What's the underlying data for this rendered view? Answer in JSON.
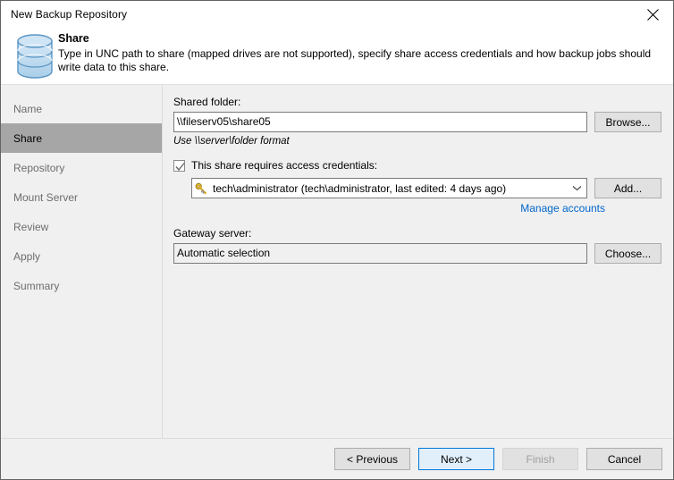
{
  "window": {
    "title": "New Backup Repository",
    "close_icon": "close-icon"
  },
  "header": {
    "icon": "database-icon",
    "title": "Share",
    "description": "Type in UNC path to share (mapped drives are not supported), specify share access credentials and how backup jobs should write data to this share."
  },
  "sidebar": {
    "items": [
      {
        "label": "Name",
        "active": false
      },
      {
        "label": "Share",
        "active": true
      },
      {
        "label": "Repository",
        "active": false
      },
      {
        "label": "Mount Server",
        "active": false
      },
      {
        "label": "Review",
        "active": false
      },
      {
        "label": "Apply",
        "active": false
      },
      {
        "label": "Summary",
        "active": false
      }
    ]
  },
  "main": {
    "shared_folder": {
      "label": "Shared folder:",
      "value": "\\\\fileserv05\\share05",
      "placeholder": "",
      "browse_button": "Browse...",
      "hint": "Use \\\\server\\folder format"
    },
    "credentials": {
      "checkbox_label": "This share requires access credentials:",
      "checked": true,
      "account_icon": "key-icon",
      "selected_account": "tech\\administrator (tech\\administrator, last edited: 4 days ago)",
      "add_button": "Add...",
      "manage_link": "Manage accounts"
    },
    "gateway": {
      "label": "Gateway server:",
      "value": "Automatic selection",
      "choose_button": "Choose..."
    }
  },
  "footer": {
    "previous": "< Previous",
    "next": "Next >",
    "finish": "Finish",
    "cancel": "Cancel"
  },
  "colors": {
    "accent": "#0078d7",
    "link": "#0066cc",
    "active_nav": "#a6a6a6",
    "panel": "#f0f0f0"
  }
}
